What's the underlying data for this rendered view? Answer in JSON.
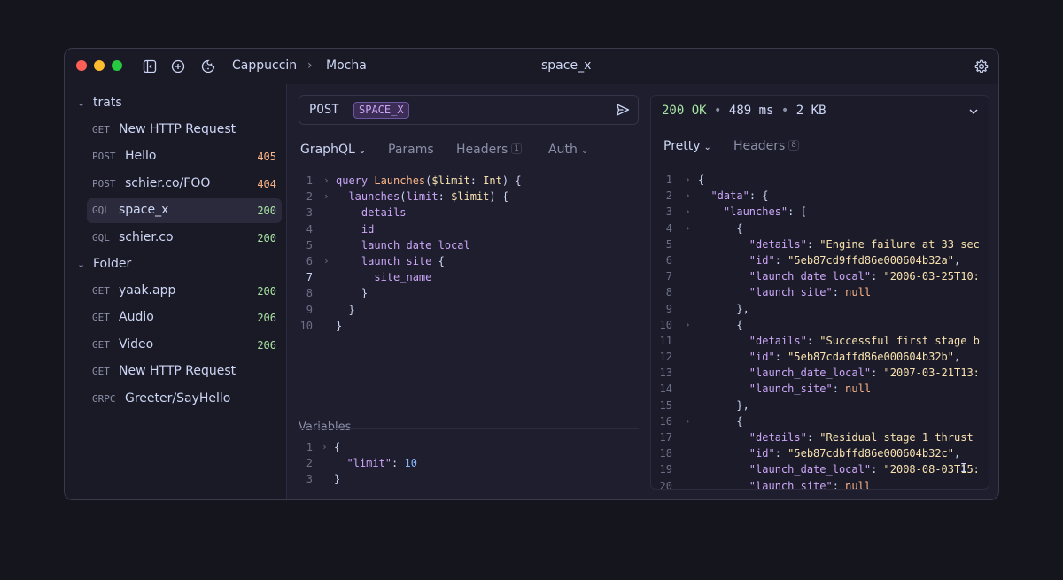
{
  "titlebar": {
    "breadcrumb_workspace": "Cappuccin",
    "breadcrumb_separator": "›",
    "breadcrumb_environment": "Mocha",
    "title": "space_x"
  },
  "sidebar": {
    "folders": [
      {
        "name": "trats",
        "items": [
          {
            "method": "GET",
            "name": "New HTTP Request",
            "status": ""
          },
          {
            "method": "POST",
            "name": "Hello",
            "status": "405"
          },
          {
            "method": "POST",
            "name": "schier.co/FOO",
            "status": "404"
          },
          {
            "method": "GQL",
            "name": "space_x",
            "status": "200"
          },
          {
            "method": "GQL",
            "name": "schier.co",
            "status": "200"
          }
        ]
      },
      {
        "name": "Folder",
        "items": [
          {
            "method": "GET",
            "name": "yaak.app",
            "status": "200"
          },
          {
            "method": "GET",
            "name": "Audio",
            "status": "206"
          },
          {
            "method": "GET",
            "name": "Video",
            "status": "206"
          },
          {
            "method": "GET",
            "name": "New HTTP Request",
            "status": ""
          },
          {
            "method": "GRPC",
            "name": "Greeter/SayHello",
            "status": ""
          }
        ]
      }
    ]
  },
  "request": {
    "method": "POST",
    "url_tag": "SPACE_X",
    "tabs": {
      "body": "GraphQL",
      "params": "Params",
      "headers": "Headers",
      "headers_count": "1",
      "auth": "Auth"
    },
    "query_lines": [
      [
        "1",
        "query Launches($limit: Int) {"
      ],
      [
        "2",
        "  launches(limit: $limit) {"
      ],
      [
        "3",
        "    details"
      ],
      [
        "4",
        "    id"
      ],
      [
        "5",
        "    launch_date_local"
      ],
      [
        "6",
        "    launch_site {"
      ],
      [
        "7",
        "      site_name"
      ],
      [
        "8",
        "    }"
      ],
      [
        "9",
        "  }"
      ],
      [
        "10",
        "}"
      ]
    ],
    "variables_label": "Variables",
    "variables_lines": [
      [
        "1",
        "{"
      ],
      [
        "2",
        "  \"limit\": 10"
      ],
      [
        "3",
        "}"
      ]
    ]
  },
  "response": {
    "status_code": "200 OK",
    "separator": "•",
    "time": "489 ms",
    "size": "2 KB",
    "tabs": {
      "pretty": "Pretty",
      "headers": "Headers",
      "headers_count": "8"
    },
    "lines": [
      [
        "1",
        "{"
      ],
      [
        "2",
        "  \"data\": {"
      ],
      [
        "3",
        "    \"launches\": ["
      ],
      [
        "4",
        "      {"
      ],
      [
        "5",
        "        \"details\": \"Engine failure at 33 sec"
      ],
      [
        "6",
        "        \"id\": \"5eb87cd9ffd86e000604b32a\","
      ],
      [
        "7",
        "        \"launch_date_local\": \"2006-03-25T10:"
      ],
      [
        "8",
        "        \"launch_site\": null"
      ],
      [
        "9",
        "      },"
      ],
      [
        "10",
        "      {"
      ],
      [
        "11",
        "        \"details\": \"Successful first stage b"
      ],
      [
        "12",
        "        \"id\": \"5eb87cdaffd86e000604b32b\","
      ],
      [
        "13",
        "        \"launch_date_local\": \"2007-03-21T13:"
      ],
      [
        "14",
        "        \"launch_site\": null"
      ],
      [
        "15",
        "      },"
      ],
      [
        "16",
        "      {"
      ],
      [
        "17",
        "        \"details\": \"Residual stage 1 thrust"
      ],
      [
        "18",
        "        \"id\": \"5eb87cdbffd86e000604b32c\","
      ],
      [
        "19",
        "        \"launch_date_local\": \"2008-08-03T15:"
      ],
      [
        "20",
        "        \"launch_site\": null"
      ]
    ]
  },
  "colors": {
    "status_4xx": "#fab387",
    "status_2xx": "#a6e3a1",
    "accent_purple": "#cba6f7"
  }
}
